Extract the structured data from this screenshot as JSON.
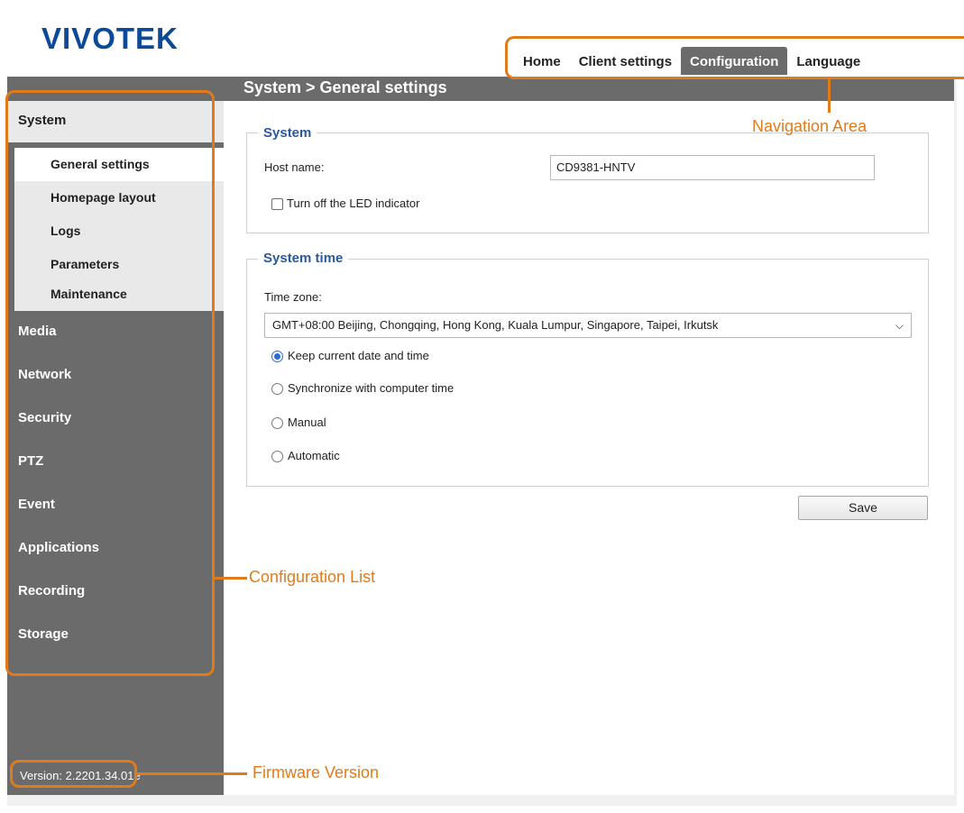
{
  "brand": {
    "logo": "VIVOTEK",
    "logo_color": "#0b4a98"
  },
  "nav": {
    "items": [
      {
        "label": "Home"
      },
      {
        "label": "Client settings"
      },
      {
        "label": "Configuration",
        "active": true
      },
      {
        "label": "Language"
      }
    ]
  },
  "breadcrumb": "System  > General settings",
  "sidebar": {
    "system_label": "System",
    "sub_items": [
      {
        "label": "General settings",
        "active": true
      },
      {
        "label": "Homepage layout"
      },
      {
        "label": "Logs"
      },
      {
        "label": "Parameters"
      },
      {
        "label": "Maintenance"
      }
    ],
    "categories": [
      {
        "label": "Media"
      },
      {
        "label": "Network"
      },
      {
        "label": "Security"
      },
      {
        "label": "PTZ"
      },
      {
        "label": "Event"
      },
      {
        "label": "Applications"
      },
      {
        "label": "Recording"
      },
      {
        "label": "Storage"
      }
    ],
    "version": "Version: 2.2201.34.01e"
  },
  "system_section": {
    "legend": "System",
    "host_label": "Host name:",
    "host_value": "CD9381-HNTV",
    "led_label": "Turn off the LED indicator",
    "led_checked": false
  },
  "time_section": {
    "legend": "System time",
    "timezone_label": "Time zone:",
    "timezone_value": "GMT+08:00 Beijing, Chongqing, Hong Kong, Kuala Lumpur, Singapore, Taipei, Irkutsk",
    "options": [
      {
        "label": "Keep current date and time",
        "checked": true
      },
      {
        "label": "Synchronize with computer time",
        "checked": false
      },
      {
        "label": "Manual",
        "checked": false
      },
      {
        "label": "Automatic",
        "checked": false
      }
    ]
  },
  "save_label": "Save",
  "annotations": {
    "navigation": "Navigation Area",
    "config_list": "Configuration List",
    "firmware": "Firmware Version",
    "color": "#e07b1c"
  }
}
